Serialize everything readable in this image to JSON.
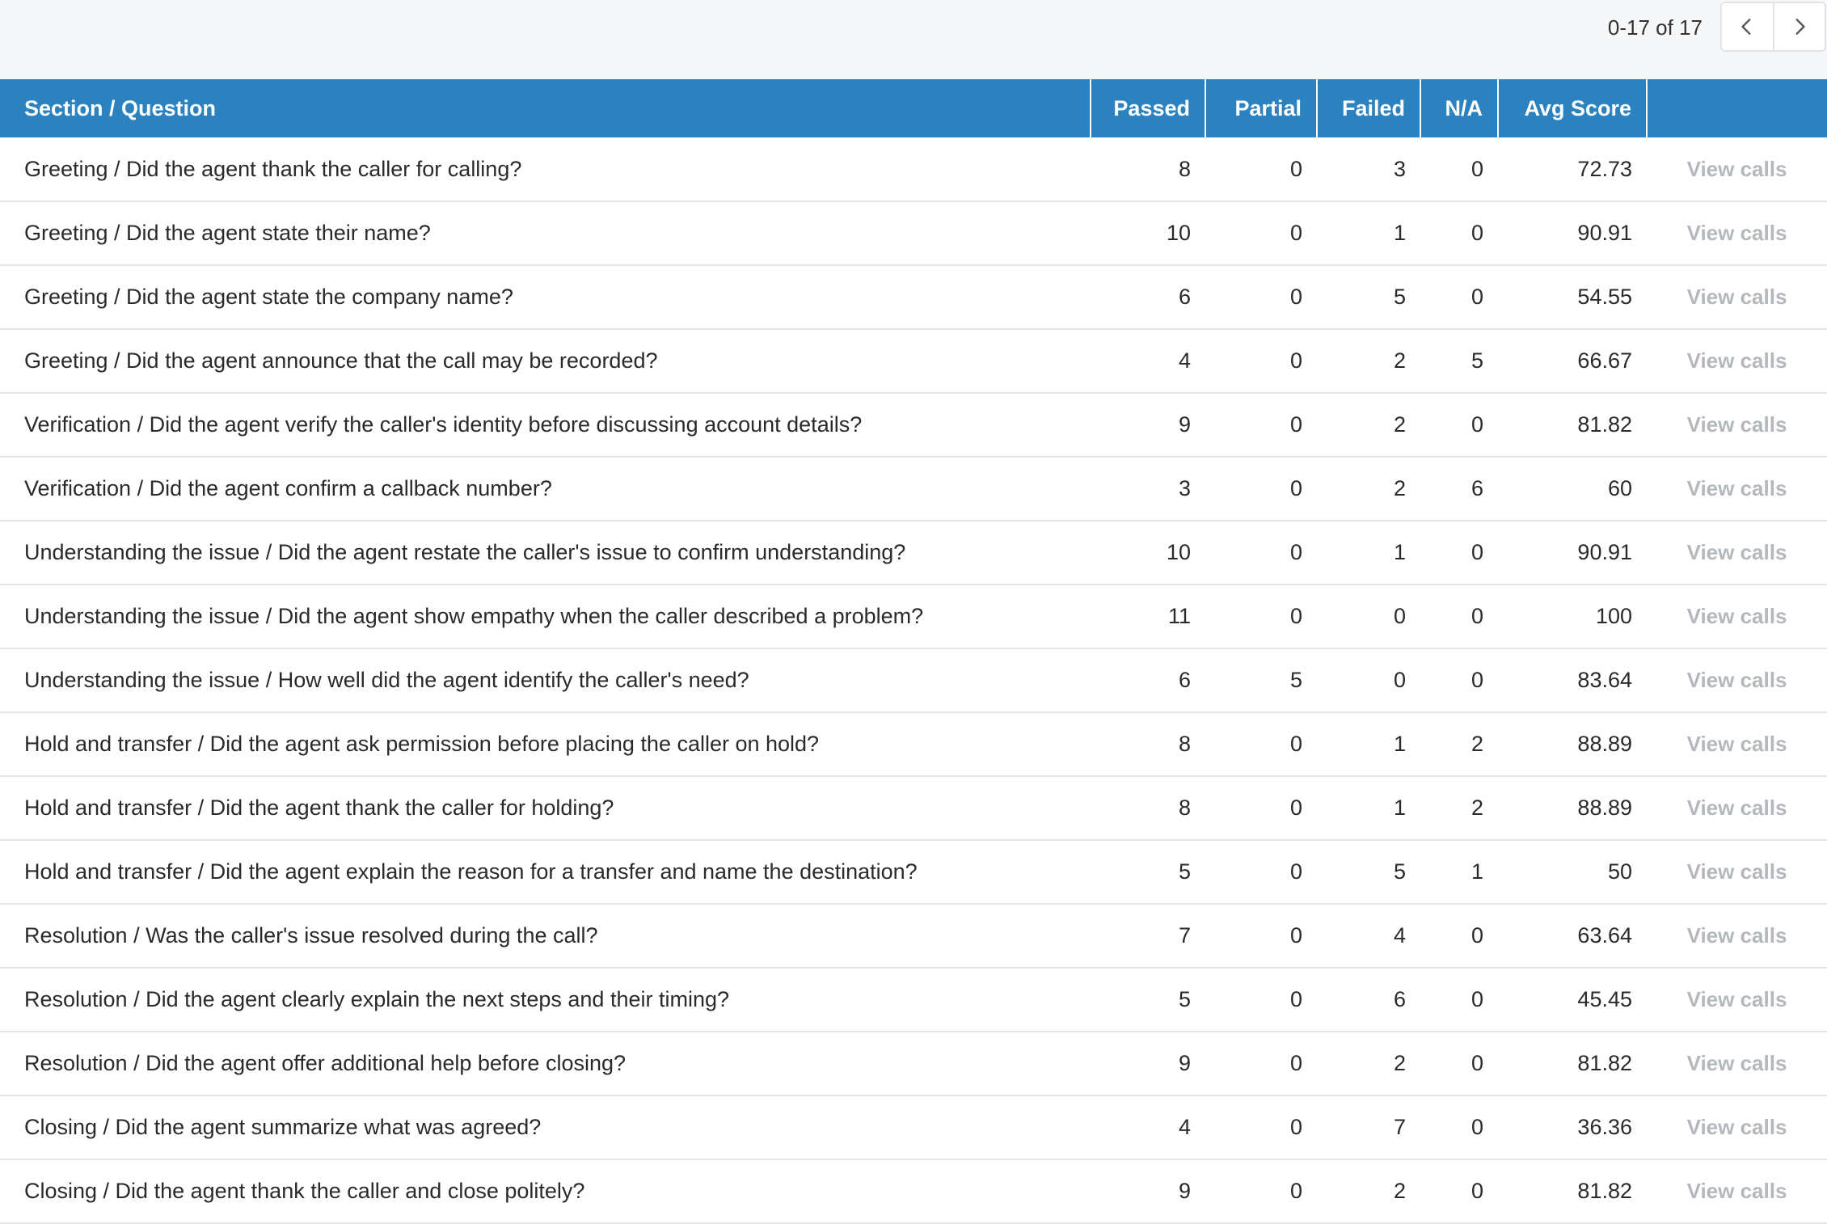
{
  "pagination": {
    "range_text": "0-17 of 17",
    "prev_icon": "chevron-left-icon",
    "next_icon": "chevron-right-icon"
  },
  "table": {
    "headers": [
      "Section / Question",
      "Passed",
      "Partial",
      "Failed",
      "N/A",
      "Avg Score",
      ""
    ],
    "action_label": "View calls",
    "header_color": "#2b82be",
    "rows": [
      {
        "question": "Greeting / Did the agent thank the caller for calling?",
        "passed": "8",
        "partial": "0",
        "failed": "3",
        "na": "0",
        "avg": "72.73"
      },
      {
        "question": "Greeting / Did the agent state their name?",
        "passed": "10",
        "partial": "0",
        "failed": "1",
        "na": "0",
        "avg": "90.91"
      },
      {
        "question": "Greeting / Did the agent state the company name?",
        "passed": "6",
        "partial": "0",
        "failed": "5",
        "na": "0",
        "avg": "54.55"
      },
      {
        "question": "Greeting / Did the agent announce that the call may be recorded?",
        "passed": "4",
        "partial": "0",
        "failed": "2",
        "na": "5",
        "avg": "66.67"
      },
      {
        "question": "Verification / Did the agent verify the caller's identity before discussing account details?",
        "passed": "9",
        "partial": "0",
        "failed": "2",
        "na": "0",
        "avg": "81.82"
      },
      {
        "question": "Verification / Did the agent confirm a callback number?",
        "passed": "3",
        "partial": "0",
        "failed": "2",
        "na": "6",
        "avg": "60"
      },
      {
        "question": "Understanding the issue / Did the agent restate the caller's issue to confirm understanding?",
        "passed": "10",
        "partial": "0",
        "failed": "1",
        "na": "0",
        "avg": "90.91"
      },
      {
        "question": "Understanding the issue / Did the agent show empathy when the caller described a problem?",
        "passed": "11",
        "partial": "0",
        "failed": "0",
        "na": "0",
        "avg": "100"
      },
      {
        "question": "Understanding the issue / How well did the agent identify the caller's need?",
        "passed": "6",
        "partial": "5",
        "failed": "0",
        "na": "0",
        "avg": "83.64"
      },
      {
        "question": "Hold and transfer / Did the agent ask permission before placing the caller on hold?",
        "passed": "8",
        "partial": "0",
        "failed": "1",
        "na": "2",
        "avg": "88.89"
      },
      {
        "question": "Hold and transfer / Did the agent thank the caller for holding?",
        "passed": "8",
        "partial": "0",
        "failed": "1",
        "na": "2",
        "avg": "88.89"
      },
      {
        "question": "Hold and transfer / Did the agent explain the reason for a transfer and name the destination?",
        "passed": "5",
        "partial": "0",
        "failed": "5",
        "na": "1",
        "avg": "50"
      },
      {
        "question": "Resolution / Was the caller's issue resolved during the call?",
        "passed": "7",
        "partial": "0",
        "failed": "4",
        "na": "0",
        "avg": "63.64"
      },
      {
        "question": "Resolution / Did the agent clearly explain the next steps and their timing?",
        "passed": "5",
        "partial": "0",
        "failed": "6",
        "na": "0",
        "avg": "45.45"
      },
      {
        "question": "Resolution / Did the agent offer additional help before closing?",
        "passed": "9",
        "partial": "0",
        "failed": "2",
        "na": "0",
        "avg": "81.82"
      },
      {
        "question": "Closing / Did the agent summarize what was agreed?",
        "passed": "4",
        "partial": "0",
        "failed": "7",
        "na": "0",
        "avg": "36.36"
      },
      {
        "question": "Closing / Did the agent thank the caller and close politely?",
        "passed": "9",
        "partial": "0",
        "failed": "2",
        "na": "0",
        "avg": "81.82"
      }
    ]
  }
}
